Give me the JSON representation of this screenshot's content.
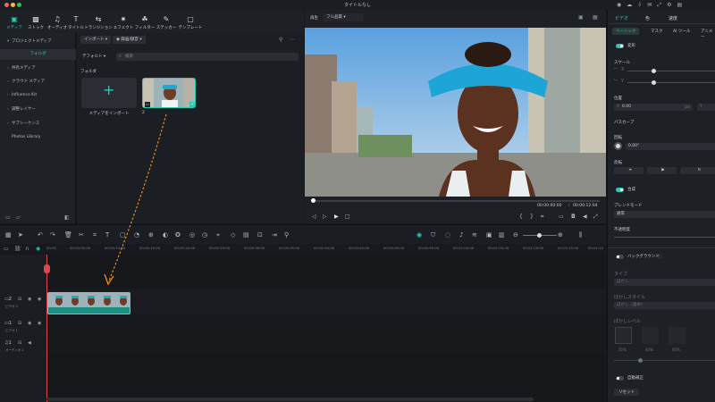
{
  "window": {
    "title": "タイトルなし"
  },
  "toolbar": {
    "items": [
      {
        "label": "メディア",
        "icon": "media-icon",
        "active": true
      },
      {
        "label": "ストック",
        "icon": "stock-icon"
      },
      {
        "label": "オーディオ",
        "icon": "audio-icon"
      },
      {
        "label": "タイトル",
        "icon": "title-icon"
      },
      {
        "label": "トランジション",
        "icon": "transition-icon"
      },
      {
        "label": "エフェクト",
        "icon": "effect-icon"
      },
      {
        "label": "フィルター",
        "icon": "filter-icon"
      },
      {
        "label": "ステッカー",
        "icon": "sticker-icon"
      },
      {
        "label": "テンプレート",
        "icon": "template-icon"
      }
    ]
  },
  "sidebar": {
    "items": [
      {
        "label": "プロジェクトメディア"
      },
      {
        "label": "フォルダ",
        "selected": true
      },
      {
        "label": "共有メディア"
      },
      {
        "label": "クラウド メディア"
      },
      {
        "label": "Influence Kit"
      },
      {
        "label": "調整レイヤー"
      },
      {
        "label": "サブシーケンス"
      },
      {
        "label": "Photos Library"
      }
    ]
  },
  "media": {
    "import_label": "インポート",
    "record_label": "録画/録音",
    "sort_label": "デフォルト",
    "search_placeholder": "検索",
    "folder_label": "フォルダ",
    "import_card_label": "メディアをインポート",
    "clip_name": "2"
  },
  "preview": {
    "play_label": "再生",
    "quality_label": "フル品質",
    "current_time": "00:00:00:00",
    "separator": "/",
    "total_time": "00:00:12:04"
  },
  "inspector": {
    "tabs": [
      "ビデオ",
      "色",
      "速度"
    ],
    "subtabs": [
      "ベーシック",
      "マスク",
      "AI ツール",
      "アニメー"
    ],
    "transform_label": "変形",
    "scale_label": "スケール",
    "scale_x_label": "X",
    "scale_y_label": "Y",
    "position_label": "位置",
    "pos_x_label": "X",
    "pos_x_value": "0.00",
    "pos_x_unit": "px",
    "pos_y_label": "Y",
    "path_curve_label": "パスカーブ",
    "rotate_label": "回転",
    "rotate_value": "0.00°",
    "flip_label": "反転",
    "composite_label": "合成",
    "blend_mode_label": "ブレンドモード",
    "blend_mode_value": "通常",
    "opacity_label": "不透明度",
    "background_label": "バックグラウンド",
    "type_label": "タイプ",
    "type_value": "ぼかし",
    "blur_style_label": "ぼかしスタイル",
    "blur_style_value": "ぼかし（基本）",
    "blur_level_label": "ぼかしレベル",
    "blur_levels": [
      "20%",
      "40%",
      "60%"
    ],
    "auto_enhance_label": "自動補正",
    "reset_label": "リセット"
  },
  "timeline": {
    "ticks": [
      "00:00",
      "00:00:05:00",
      "00:00:10:00",
      "00:00:15:00",
      "00:00:20:00",
      "00:00:25:00",
      "00:00:30:00",
      "00:00:35:00",
      "00:00:40:00",
      "00:00:45:00",
      "00:00:50:00",
      "00:00:55:00",
      "00:01:00:00",
      "00:01:05:00",
      "00:01:10:00",
      "00:01:15:00",
      "00:01:20"
    ],
    "tracks": [
      {
        "num": "2",
        "label": "ビデオ 2"
      },
      {
        "num": "1",
        "label": "ビデオ 1"
      },
      {
        "num": "1",
        "label": "オーディオ 1"
      }
    ]
  },
  "colors": {
    "accent": "#28c9b5",
    "clip": "#1f8f83",
    "playhead": "#e0464b",
    "arrow": "#e58a1f"
  }
}
